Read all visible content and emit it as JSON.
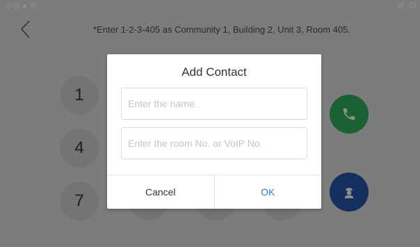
{
  "status_bar": {
    "left_icons": [
      "circle-icon",
      "circle-icon",
      "cloud-icon",
      "at-icon"
    ],
    "right_icons": [
      "network-icon",
      "screen-icon"
    ]
  },
  "header": {
    "back_icon": "chevron-left-icon",
    "hint": "*Enter 1-2-3-405 as Community 1, Building 2, Unit 3, Room 405."
  },
  "keypad": {
    "visible_keys": [
      "1",
      "4",
      "7"
    ]
  },
  "actions": {
    "call_icon": "phone-icon",
    "call_color": "#2fae5b",
    "guard_icon": "guard-icon",
    "guard_color": "#2756a8"
  },
  "dialog": {
    "title": "Add Contact",
    "name_value": "",
    "name_placeholder": "Enter the name.",
    "room_value": "",
    "room_placeholder": "Enter the room No. or VoIP No.",
    "cancel_label": "Cancel",
    "ok_label": "OK",
    "ok_color": "#2b74e2"
  }
}
